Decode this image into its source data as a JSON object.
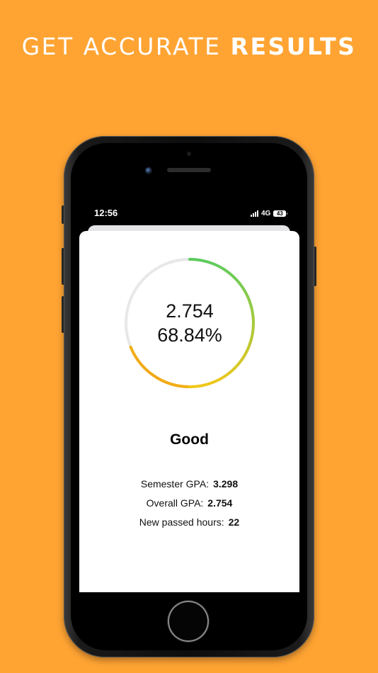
{
  "headline": {
    "regular": "GET ACCURATE",
    "bold": "RESULTS"
  },
  "status_bar": {
    "time": "12:56",
    "network": "4G",
    "battery": "43"
  },
  "gauge": {
    "gpa": "2.754",
    "percentage": "68.84%",
    "fraction": 0.6884,
    "colors": {
      "track": "#e8e8e8",
      "start": "#F29A13",
      "mid": "#F2C718",
      "end": "#5CCB5F"
    }
  },
  "result": {
    "rating": "Good",
    "semester_gpa_label": "Semester GPA:",
    "semester_gpa_value": "3.298",
    "overall_gpa_label": "Overall GPA:",
    "overall_gpa_value": "2.754",
    "passed_hours_label": "New passed hours:",
    "passed_hours_value": "22"
  },
  "colors": {
    "background": "#FFA433",
    "accent": "#5CCB5F"
  }
}
